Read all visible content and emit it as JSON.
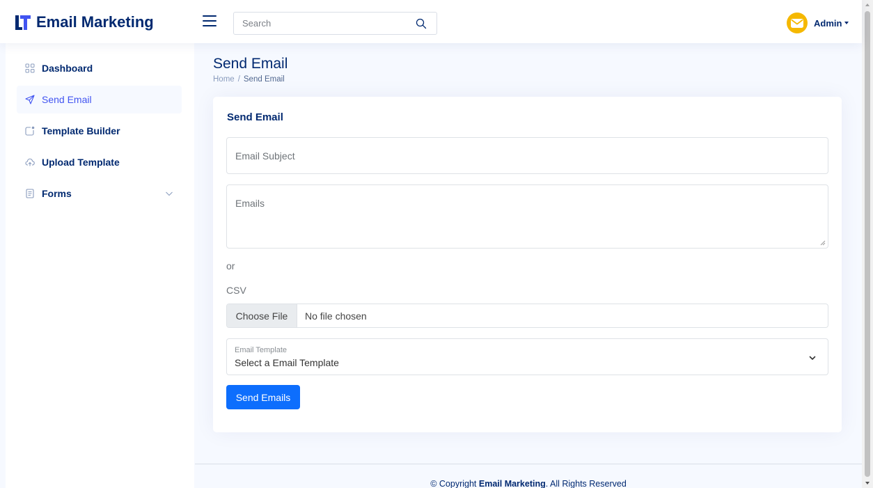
{
  "app": {
    "title": "Email Marketing",
    "brand_color": "#012970",
    "accent_color": "#4154f1",
    "logo_icon": "logo-mark-icon"
  },
  "header": {
    "menu_icon": "hamburger-icon",
    "search": {
      "placeholder": "Search",
      "value": "",
      "icon": "search-icon"
    },
    "profile": {
      "name": "Admin",
      "avatar_icon": "envelope-icon",
      "avatar_color": "#f5b800"
    }
  },
  "sidebar": {
    "items": [
      {
        "label": "Dashboard",
        "icon": "grid-icon",
        "active": false
      },
      {
        "label": "Send Email",
        "icon": "send-icon",
        "active": true
      },
      {
        "label": "Template Builder",
        "icon": "template-icon",
        "active": false
      },
      {
        "label": "Upload Template",
        "icon": "cloud-upload-icon",
        "active": false
      },
      {
        "label": "Forms",
        "icon": "form-icon",
        "active": false,
        "has_submenu": true
      }
    ]
  },
  "page": {
    "title": "Send Email",
    "breadcrumb": [
      "Home",
      "Send Email"
    ]
  },
  "form": {
    "card_title": "Send Email",
    "subject_placeholder": "Email Subject",
    "emails_placeholder": "Emails",
    "or_text": "or",
    "csv_label": "CSV",
    "file_button": "Choose File",
    "file_status": "No file chosen",
    "template_label": "Email Template",
    "template_value": "Select a Email Template",
    "submit_label": "Send Emails",
    "submit_color": "#0d6efd"
  },
  "footer": {
    "prefix": "© Copyright ",
    "brand": "Email Marketing",
    "suffix": ". All Rights Reserved"
  }
}
